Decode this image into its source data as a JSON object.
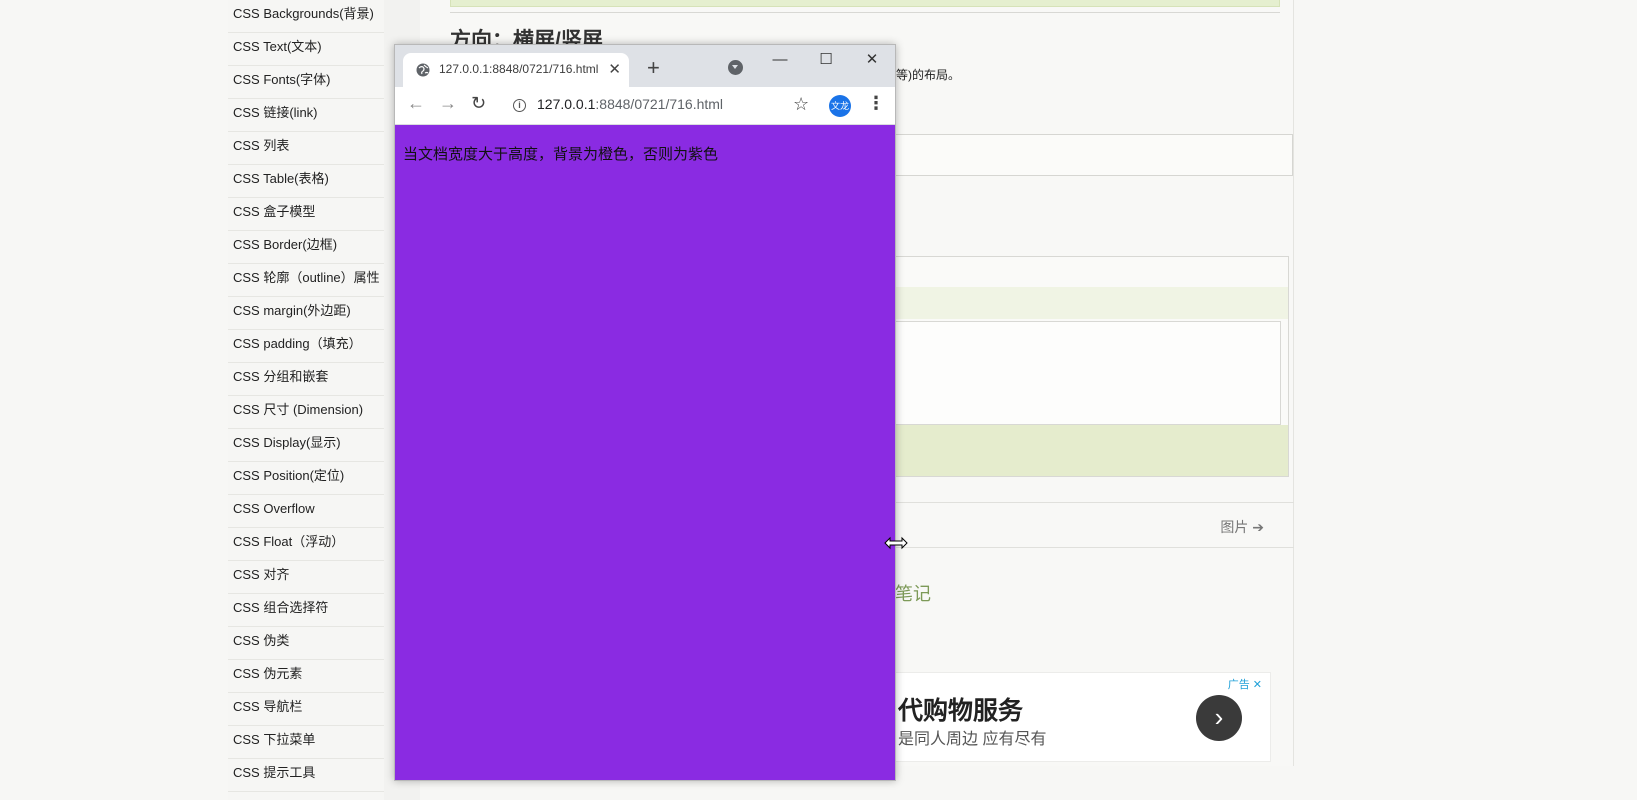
{
  "sidebar": {
    "items": [
      "CSS Backgrounds(背景)",
      "CSS Text(文本)",
      "CSS Fonts(字体)",
      "CSS 链接(link)",
      "CSS 列表",
      "CSS Table(表格)",
      "CSS 盒子模型",
      "CSS Border(边框)",
      "CSS 轮廓（outline）属性",
      "CSS margin(外边距)",
      "CSS padding（填充）",
      "CSS 分组和嵌套",
      "CSS 尺寸 (Dimension)",
      "CSS Display(显示)",
      "CSS Position(定位)",
      "CSS Overflow",
      "CSS Float（浮动）",
      "CSS 对齐",
      "CSS 组合选择符",
      "CSS 伪类",
      "CSS 伪元素",
      "CSS 导航栏",
      "CSS 下拉菜单",
      "CSS 提示工具"
    ]
  },
  "content": {
    "section_title": "方向：横屏/竖屏",
    "partial_text": "等)的布局。",
    "next_link": "图片",
    "notes_heading": "笔记",
    "ad": {
      "label": "广告",
      "title": "代购物服务",
      "subtitle": "是同人周边 应有尽有"
    }
  },
  "browser": {
    "tab_title": "127.0.0.1:8848/0721/716.html",
    "url_host": "127.0.0.1",
    "url_path": ":8848/0721/716.html",
    "avatar_label": "文龙",
    "viewport_text": "当文档宽度大于高度，背景为橙色，否则为紫色",
    "viewport_bg": "#8a2be2"
  },
  "colors": {
    "accent_green": "#7d9a58",
    "ad_label": "#1fa0d8"
  }
}
